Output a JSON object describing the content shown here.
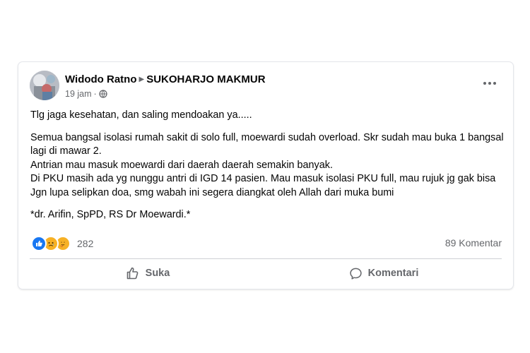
{
  "post": {
    "author": "Widodo Ratno",
    "group": "SUKOHARJO MAKMUR",
    "time": "19 jam",
    "separator": "·",
    "privacy_icon": "globe-icon",
    "more_icon": "more-options-icon",
    "paragraphs": [
      "Tlg jaga kesehatan, dan saling mendoakan ya.....",
      "Semua bangsal isolasi rumah sakit di solo full, moewardi sudah overload. Skr  sudah mau buka 1 bangsal lagi di mawar 2.",
      "Antrian mau masuk moewardi dari daerah daerah semakin banyak.",
      "Di PKU masih ada yg nunggu antri di IGD 14 pasien. Mau masuk isolasi PKU full, mau rujuk jg gak bisa",
      "Jgn lupa selipkan doa, smg wabah ini segera diangkat oleh Allah dari muka bumi",
      "*dr. Arifin, SpPD, RS Dr Moewardi.*"
    ]
  },
  "stats": {
    "reaction_icons": [
      "like-icon",
      "sad-icon",
      "care-icon"
    ],
    "reaction_count": "282",
    "comment_count": "89 Komentar"
  },
  "actions": {
    "like_label": "Suka",
    "comment_label": "Komentari"
  },
  "colors": {
    "brand_blue": "#1877f2",
    "secondary_text": "#65676b",
    "primary_text": "#050505",
    "reaction_yellow": "#f7b125"
  }
}
